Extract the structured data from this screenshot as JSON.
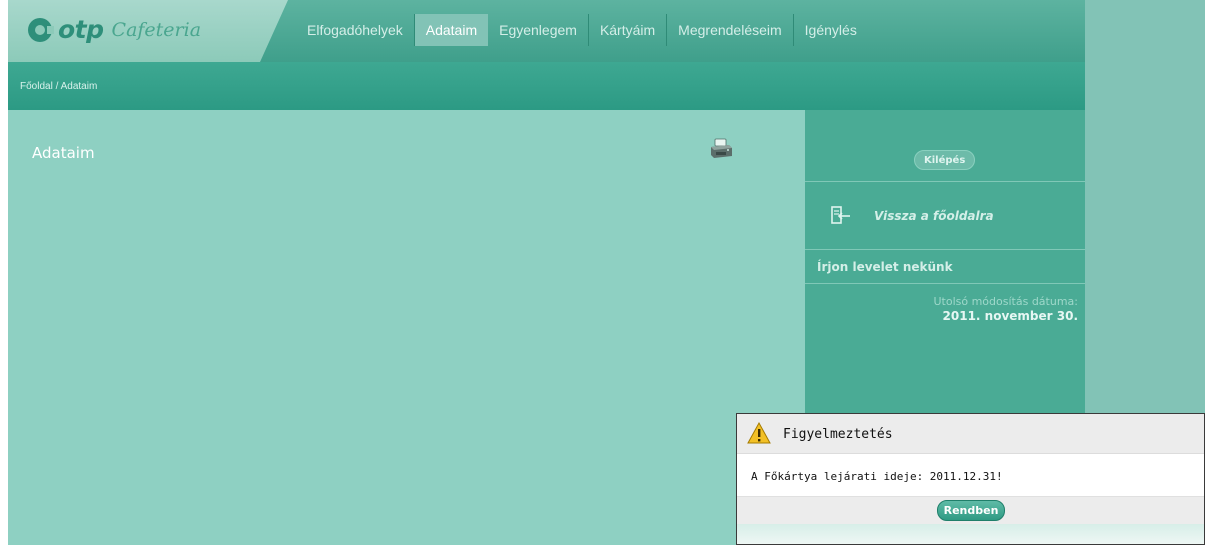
{
  "brand": {
    "logo_main": "otp",
    "logo_sub": "Cafeteria"
  },
  "nav": {
    "items": [
      {
        "label": "Elfogadóhelyek",
        "active": false
      },
      {
        "label": "Adataim",
        "active": true
      },
      {
        "label": "Egyenlegem",
        "active": false
      },
      {
        "label": "Kártyáim",
        "active": false
      },
      {
        "label": "Megrendeléseim",
        "active": false
      },
      {
        "label": "Igénylés",
        "active": false
      }
    ]
  },
  "breadcrumb": {
    "home": "Főoldal",
    "separator": "/",
    "current": "Adataim"
  },
  "main": {
    "title": "Adataim",
    "print_icon": "printer-icon"
  },
  "sidebar": {
    "logout_label": "Kilépés",
    "back_label": "Vissza a főoldalra",
    "back_icon": "exit-arrow-icon",
    "write_label": "Írjon levelet nekünk",
    "modified_label": "Utolsó módosítás dátuma:",
    "modified_date": "2011. november 30."
  },
  "dialog": {
    "icon": "warning-icon",
    "title": "Figyelmeztetés",
    "message": "A Főkártya lejárati ideje: 2011.12.31!",
    "ok_label": "Rendben"
  },
  "colors": {
    "header": "#3f9f8b",
    "main_panel": "#8ed0c2",
    "sidebar": "#4aab95",
    "outer": "#82c3b6",
    "accent": "#2e8f7a"
  }
}
